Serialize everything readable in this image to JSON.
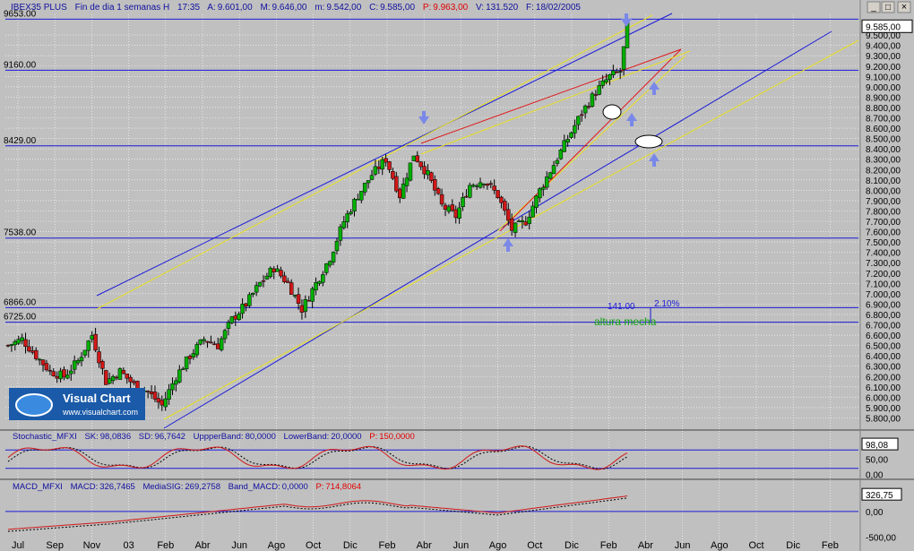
{
  "header": {
    "symbol": "IBEX35 PLUS",
    "desc": "Fin de dia 1 semanas H",
    "time": "17:35",
    "a_label": "A:",
    "a_value": "9.601,00",
    "m_label": "M:",
    "m_value": "9.646,00",
    "m2_label": "m:",
    "m2_value": "9.542,00",
    "c_label": "C:",
    "c_value": "9.585,00",
    "p_label": "P:",
    "p_value": "9.963,00",
    "v_label": "V:",
    "v_value": "131.520",
    "f_label": "F:",
    "f_value": "18/02/2005"
  },
  "window_controls": {
    "minimize": "_",
    "maximize": "□",
    "close": "×"
  },
  "price_panel": {
    "ylim": [
      5700,
      9700
    ],
    "y_ticks": [
      5800,
      5900,
      6000,
      6100,
      6200,
      6300,
      6400,
      6500,
      6600,
      6700,
      6800,
      6900,
      7000,
      7100,
      7200,
      7300,
      7400,
      7500,
      7600,
      7700,
      7800,
      7900,
      8000,
      8100,
      8200,
      8300,
      8400,
      8500,
      8600,
      8700,
      8800,
      8900,
      9000,
      9100,
      9200,
      9300,
      9400,
      9500
    ],
    "y_tick_labels": [
      "5.800,00",
      "5.900,00",
      "6.000,00",
      "6.100,00",
      "6.200,00",
      "6.300,00",
      "6.400,00",
      "6.500,00",
      "6.600,00",
      "6.700,00",
      "6.800,00",
      "6.900,00",
      "7.000,00",
      "7.100,00",
      "7.200,00",
      "7.300,00",
      "7.400,00",
      "7.500,00",
      "7.600,00",
      "7.700,00",
      "7.800,00",
      "7.900,00",
      "8.000,00",
      "8.100,00",
      "8.200,00",
      "8.300,00",
      "8.400,00",
      "8.500,00",
      "8.600,00",
      "8.700,00",
      "8.800,00",
      "8.900,00",
      "9.000,00",
      "9.100,00",
      "9.200,00",
      "9.300,00",
      "9.400,00",
      "9.500,00"
    ],
    "last_price": 9585,
    "last_price_label": "9.585,00",
    "levels": [
      {
        "value": 9653,
        "label": "9653.00"
      },
      {
        "value": 9160,
        "label": "9160.00"
      },
      {
        "value": 8429,
        "label": "8429.00"
      },
      {
        "value": 7538,
        "label": "7538.00"
      },
      {
        "value": 6866,
        "label": "6866.00"
      },
      {
        "value": 6725,
        "label": "6725.00"
      }
    ],
    "measure_text": "141.00",
    "measure_pct": "2.10%",
    "annotation": "altura mecha",
    "watermark_title": "Visual Chart",
    "watermark_url": "www.visualchart.com"
  },
  "chart_data": {
    "type": "candlestick",
    "period": "weekly",
    "y_range": [
      5700,
      9700
    ],
    "series": [
      {
        "name": "IBEX35 PLUS",
        "close_path_anchors": [
          [
            0,
            6500
          ],
          [
            4,
            6560
          ],
          [
            8,
            6400
          ],
          [
            12,
            6250
          ],
          [
            16,
            6200
          ],
          [
            20,
            6350
          ],
          [
            24,
            6600
          ],
          [
            28,
            6150
          ],
          [
            32,
            6250
          ],
          [
            36,
            6120
          ],
          [
            40,
            6050
          ],
          [
            44,
            5920
          ],
          [
            48,
            6200
          ],
          [
            52,
            6400
          ],
          [
            56,
            6560
          ],
          [
            60,
            6500
          ],
          [
            64,
            6750
          ],
          [
            68,
            6900
          ],
          [
            72,
            7100
          ],
          [
            76,
            7250
          ],
          [
            80,
            7100
          ],
          [
            84,
            6850
          ],
          [
            88,
            7100
          ],
          [
            92,
            7350
          ],
          [
            96,
            7700
          ],
          [
            100,
            7950
          ],
          [
            104,
            8150
          ],
          [
            108,
            8300
          ],
          [
            112,
            7950
          ],
          [
            116,
            8350
          ],
          [
            120,
            8150
          ],
          [
            124,
            7850
          ],
          [
            128,
            7750
          ],
          [
            132,
            8050
          ],
          [
            136,
            8100
          ],
          [
            140,
            7950
          ],
          [
            144,
            7620
          ],
          [
            148,
            7700
          ],
          [
            152,
            8000
          ],
          [
            156,
            8250
          ],
          [
            160,
            8500
          ],
          [
            164,
            8750
          ],
          [
            168,
            8950
          ],
          [
            172,
            9100
          ],
          [
            175,
            9150
          ],
          [
            177,
            9585
          ]
        ]
      }
    ],
    "x_tick_labels": [
      "Jul",
      "Sep",
      "Nov",
      "03",
      "Feb",
      "Abr",
      "Jun",
      "Ago",
      "Oct",
      "Dic",
      "Feb",
      "Abr",
      "Jun",
      "Ago",
      "Oct",
      "Dic",
      "Feb",
      "Abr",
      "Jun",
      "Ago",
      "Oct",
      "Dic",
      "Feb"
    ],
    "horizontal_levels": [
      9653,
      9160,
      8429,
      7538,
      6866,
      6725
    ]
  },
  "stochastic": {
    "title": "Stochastic_MFXI",
    "sk_label": "SK:",
    "sk_value": "98,0836",
    "sd_label": "SD:",
    "sd_value": "96,7642",
    "ub_label": "UppperBand:",
    "ub_value": "80,0000",
    "lb_label": "LowerBand:",
    "lb_value": "20,0000",
    "p_label": "P:",
    "p_value": "150,0000",
    "ylim": [
      -10,
      110
    ],
    "ticks": [
      0,
      50
    ],
    "tick_labels": [
      "0,00",
      "50,00"
    ],
    "last_label": "98,08",
    "upper_band": 80,
    "lower_band": 20
  },
  "macd": {
    "title": "MACD_MFXI",
    "macd_label": "MACD:",
    "macd_value": "326,7465",
    "sig_label": "MediaSIG:",
    "sig_value": "269,2758",
    "band_label": "Band_MACD:",
    "band_value": "0,0000",
    "p_label": "P:",
    "p_value": "714,8064",
    "ylim": [
      -650,
      400
    ],
    "ticks": [
      0,
      -500
    ],
    "tick_labels": [
      "0,00",
      "-500,00"
    ],
    "last_label": "326,75"
  },
  "colors": {
    "bg": "#c0c0c0",
    "grid": "#ffffff",
    "level": "#1a1ad8",
    "up": "#00b000",
    "down": "#d01818",
    "yellow": "#e8e020",
    "blue_channel": "#1a1ad8",
    "red_channel": "#e01818",
    "arrow": "#7a88e8",
    "header": "#1010a0",
    "header_p": "#e00000"
  }
}
